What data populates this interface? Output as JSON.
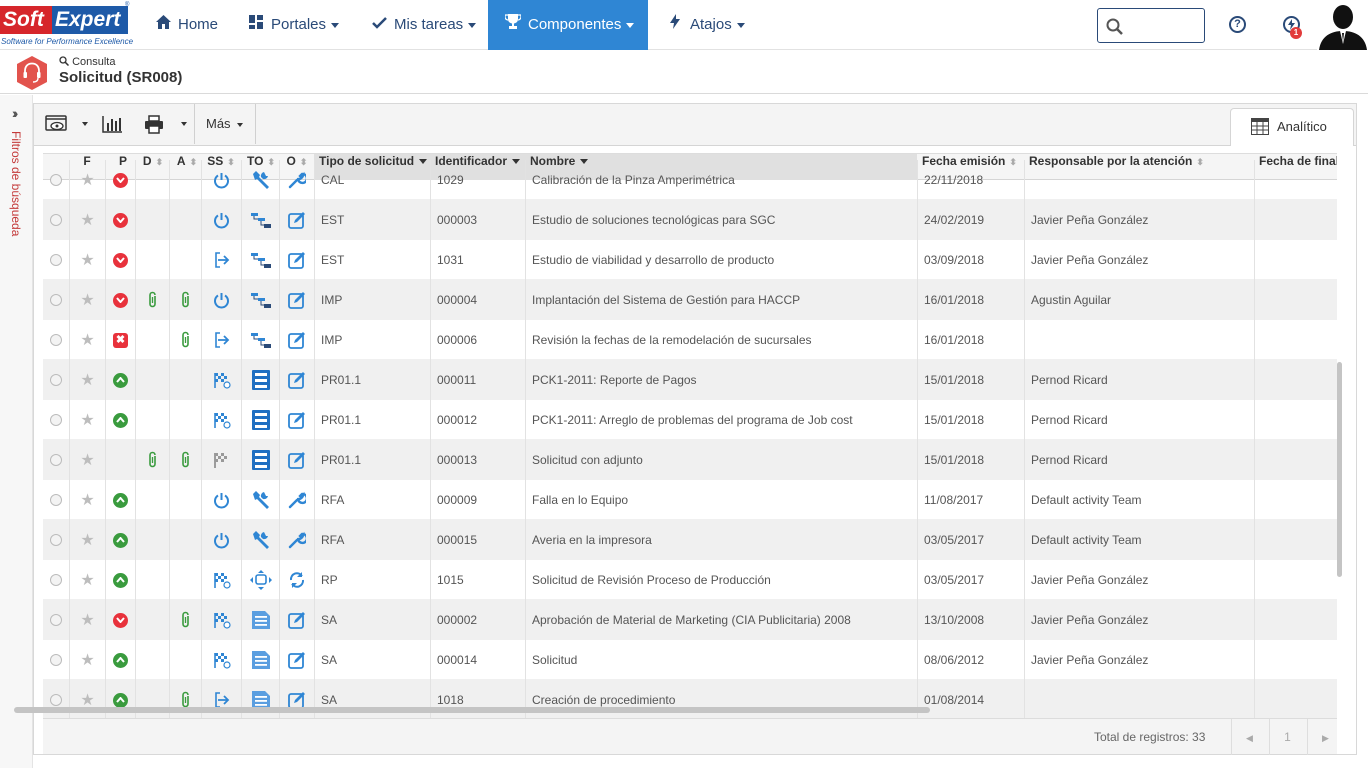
{
  "brand": {
    "soft": "Soft",
    "expert": "Expert",
    "tagline": "Software for Performance Excellence",
    "reg": "®"
  },
  "nav": {
    "home": "Home",
    "portales": "Portales",
    "mis_tareas": "Mis tareas",
    "componentes": "Componentes",
    "atajos": "Atajos"
  },
  "header": {
    "help_icon": "?",
    "notifications_count": "1"
  },
  "page": {
    "breadcrumb": "Consulta",
    "title": "Solicitud (SR008)"
  },
  "sidebar": {
    "filter_label": "Filtros de búsqueda"
  },
  "toolbar": {
    "mas_label": "Más",
    "tab_label": "Analítico"
  },
  "columns": {
    "f": "F",
    "p": "P",
    "d": "D",
    "a": "A",
    "ss": "SS",
    "to": "TO",
    "o": "O",
    "tipo": "Tipo de solicitud",
    "identificador": "Identificador",
    "nombre": "Nombre",
    "fecha_emision": "Fecha emisión",
    "responsable": "Responsable por la atención",
    "fecha_fin": "Fecha de finalización"
  },
  "rows": [
    {
      "p": "red",
      "d": "",
      "a": "",
      "ss": "power",
      "to": "tool",
      "o": "wrench",
      "tipo": "CAL",
      "id": "1029",
      "nombre": "Calibración de la Pinza Amperimétrica",
      "fecha": "22/11/2018",
      "resp": ""
    },
    {
      "p": "red",
      "d": "",
      "a": "",
      "ss": "power",
      "to": "steps",
      "o": "edit",
      "tipo": "EST",
      "id": "000003",
      "nombre": "Estudio de soluciones tecnológicas para SGC",
      "fecha": "24/02/2019",
      "resp": "Javier Peña González"
    },
    {
      "p": "red",
      "d": "",
      "a": "",
      "ss": "enter",
      "to": "steps",
      "o": "edit",
      "tipo": "EST",
      "id": "1031",
      "nombre": "Estudio de viabilidad y desarrollo de producto",
      "fecha": "03/09/2018",
      "resp": "Javier Peña González"
    },
    {
      "p": "red",
      "d": "clip",
      "a": "clip",
      "ss": "power",
      "to": "steps",
      "o": "edit",
      "tipo": "IMP",
      "id": "000004",
      "nombre": "Implantación del Sistema de Gestión para HACCP",
      "fecha": "16/01/2018",
      "resp": "Agustin Aguilar"
    },
    {
      "p": "redbox",
      "d": "",
      "a": "clip",
      "ss": "enter",
      "to": "steps",
      "o": "edit",
      "tipo": "IMP",
      "id": "000006",
      "nombre": "Revisión la fechas de la remodelación de sucursales",
      "fecha": "16/01/2018",
      "resp": ""
    },
    {
      "p": "green",
      "d": "",
      "a": "",
      "ss": "flag",
      "to": "form",
      "o": "edit",
      "tipo": "PR01.1",
      "id": "000011",
      "nombre": "PCK1-2011: Reporte de Pagos",
      "fecha": "15/01/2018",
      "resp": "Pernod Ricard"
    },
    {
      "p": "green",
      "d": "",
      "a": "",
      "ss": "flag",
      "to": "form",
      "o": "edit",
      "tipo": "PR01.1",
      "id": "000012",
      "nombre": "PCK1-2011: Arreglo de problemas del programa de Job cost",
      "fecha": "15/01/2018",
      "resp": "Pernod Ricard"
    },
    {
      "p": "",
      "d": "clip",
      "a": "clip",
      "ss": "flaggray",
      "to": "form",
      "o": "edit",
      "tipo": "PR01.1",
      "id": "000013",
      "nombre": "Solicitud con adjunto",
      "fecha": "15/01/2018",
      "resp": "Pernod Ricard"
    },
    {
      "p": "green",
      "d": "",
      "a": "",
      "ss": "power",
      "to": "tool",
      "o": "wrench",
      "tipo": "RFA",
      "id": "000009",
      "nombre": "Falla en lo Equipo",
      "fecha": "11/08/2017",
      "resp": "Default activity Team"
    },
    {
      "p": "green",
      "d": "",
      "a": "",
      "ss": "power",
      "to": "tool",
      "o": "wrench",
      "tipo": "RFA",
      "id": "000015",
      "nombre": "Averia en la impresora",
      "fecha": "03/05/2017",
      "resp": "Default activity Team"
    },
    {
      "p": "green",
      "d": "",
      "a": "",
      "ss": "flag",
      "to": "cycle",
      "o": "refresh",
      "tipo": "RP",
      "id": "1015",
      "nombre": "Solicitud de Revisión Proceso de Producción",
      "fecha": "03/05/2017",
      "resp": "Javier Peña González"
    },
    {
      "p": "red",
      "d": "",
      "a": "clip",
      "ss": "flag",
      "to": "doc",
      "o": "edit",
      "tipo": "SA",
      "id": "000002",
      "nombre": "Aprobación de Material de Marketing (CIA Publicitaria) 2008",
      "fecha": "13/10/2008",
      "resp": "Javier Peña González"
    },
    {
      "p": "green",
      "d": "",
      "a": "",
      "ss": "flag",
      "to": "doc",
      "o": "edit",
      "tipo": "SA",
      "id": "000014",
      "nombre": "Solicitud",
      "fecha": "08/06/2012",
      "resp": "Javier Peña González"
    },
    {
      "p": "green",
      "d": "",
      "a": "clip",
      "ss": "enter",
      "to": "doc",
      "o": "edit",
      "tipo": "SA",
      "id": "1018",
      "nombre": "Creación de procedimiento",
      "fecha": "01/08/2014",
      "resp": ""
    }
  ],
  "footer": {
    "total": "Total de registros: 33",
    "page": "1",
    "prev": "◀",
    "next": "▶"
  },
  "colors": {
    "accent": "#2f86d4",
    "nav_text": "#2a4a78",
    "red": "#e8323c",
    "green": "#3a9b3e",
    "icon_blue": "#2f86d4"
  }
}
